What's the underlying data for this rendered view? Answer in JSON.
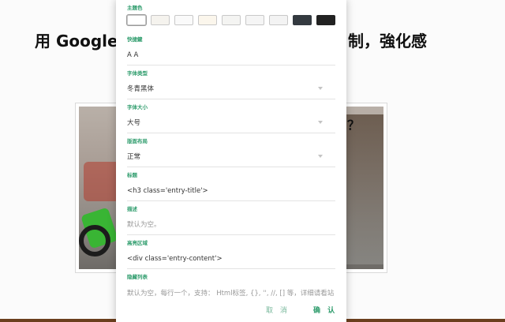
{
  "background": {
    "title_left": "用 Google",
    "title_right": "制，強化感",
    "question_mark": "？"
  },
  "panel": {
    "theme": {
      "label": "主題色",
      "swatches": [
        "#ffffff",
        "#f5f3ee",
        "#fafafa",
        "#fbf6ec",
        "#f4f4f2",
        "#f5f5f5",
        "#f3f3f3",
        "#343a40",
        "#222222"
      ]
    },
    "shortcut": {
      "label": "快捷鍵",
      "value": "A A"
    },
    "font_type": {
      "label": "字体类型",
      "value": "冬青黑体"
    },
    "font_size": {
      "label": "字体大小",
      "value": "大号"
    },
    "layout": {
      "label": "版面布局",
      "value": "正常"
    },
    "heading": {
      "label": "标题",
      "value": "<h3 class='entry-title'>"
    },
    "description": {
      "label": "描述",
      "value": "默认为空。"
    },
    "highlight": {
      "label": "高亮区域",
      "value": "<div class='entry-content'>"
    },
    "hidden_list": {
      "label": "隐藏列表",
      "value": "默认为空，每行一个，支持： Html标签, {}, '', //, [] 等，详细请看站点增强器。"
    }
  },
  "buttons": {
    "cancel": "取 消",
    "ok": "确 认"
  },
  "colors": {
    "accent": "#2e9c6c",
    "cancel": "#79b89c"
  }
}
